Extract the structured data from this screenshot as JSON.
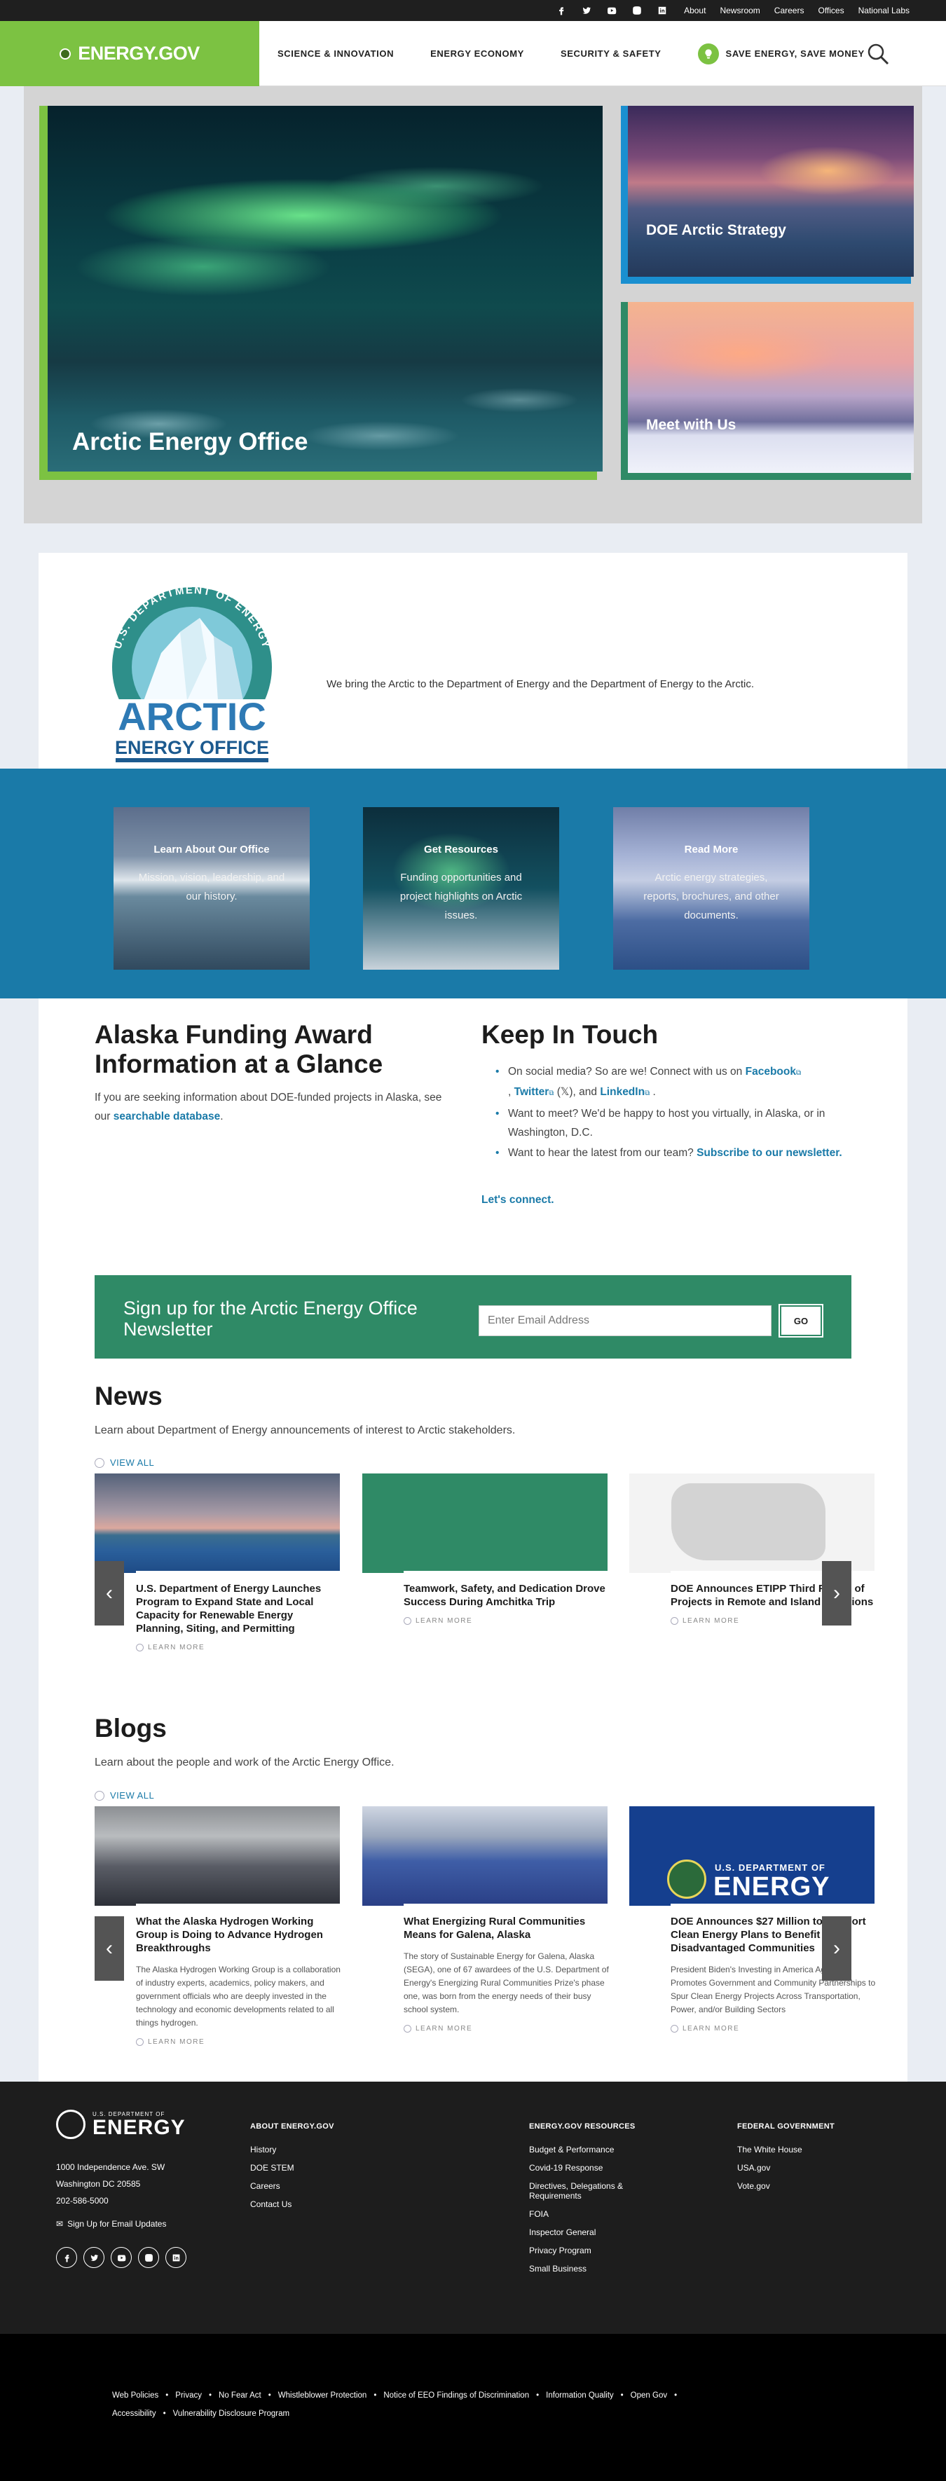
{
  "utility": {
    "icons": [
      "facebook-icon",
      "twitter-icon",
      "youtube-icon",
      "instagram-icon",
      "linkedin-icon"
    ],
    "links": [
      "About",
      "Newsroom",
      "Careers",
      "Offices",
      "National Labs"
    ]
  },
  "header": {
    "logo": "ENERGY.GOV",
    "nav": [
      "SCIENCE & INNOVATION",
      "ENERGY ECONOMY",
      "SECURITY & SAFETY"
    ],
    "save": "SAVE ENERGY, SAVE MONEY"
  },
  "hero": {
    "main_caption": "Arctic Energy Office",
    "side1_caption": "DOE Arctic Strategy",
    "side2_caption": "Meet with Us"
  },
  "intro": {
    "logo_ring": "U.S. DEPARTMENT OF ENERGY",
    "logo_line1": "ARCTIC",
    "logo_line2": "ENERGY OFFICE",
    "text": "We bring the Arctic to the Department of Energy and the Department of Energy to the Arctic."
  },
  "tiles": [
    {
      "title": "Learn About Our Office",
      "desc": "Mission, vision, leadership, and our history."
    },
    {
      "title": "Get Resources",
      "desc": "Funding opportunities and project highlights on Arctic issues."
    },
    {
      "title": "Read More",
      "desc": "Arctic energy strategies, reports, brochures, and other documents."
    }
  ],
  "funding": {
    "heading": "Alaska Funding Award Information at a Glance",
    "text": "If you are seeking information about DOE-funded projects in Alaska, see our",
    "link": "searchable database",
    "end": "."
  },
  "keep": {
    "heading": "Keep In Touch",
    "b1_pre": "On social media? So are we! Connect with us on",
    "b1_fb": "Facebook",
    "b1_mid": ",",
    "b1_tw": "Twitter",
    "b1_x": " (𝕏), and",
    "b1_li": "LinkedIn",
    "b1_end": ".",
    "b2": "Want to meet? We'd be happy to host you virtually, in Alaska, or in Washington, D.C.",
    "b3_pre": "Want to hear the latest from our team?",
    "b3_link": "Subscribe to our newsletter.",
    "cta": "Let's connect."
  },
  "newsletter": {
    "label": "Sign up for the Arctic Energy Office Newsletter",
    "placeholder": "Enter Email Address",
    "button": "GO"
  },
  "news": {
    "heading": "News",
    "text": "Learn about Department of Energy announcements of interest to Arctic stakeholders.",
    "view_all": "VIEW ALL",
    "more": "LEARN MORE",
    "items": [
      {
        "title": "U.S. Department of Energy Launches Program to Expand State and Local Capacity for Renewable Energy Planning, Siting, and Permitting"
      },
      {
        "title": "Teamwork, Safety, and Dedication Drove Success During Amchitka Trip"
      },
      {
        "title": "DOE Announces ETIPP Third Round of Projects in Remote and Island Locations"
      }
    ]
  },
  "blogs": {
    "heading": "Blogs",
    "text": "Learn about the people and work of the Arctic Energy Office.",
    "view_all": "VIEW ALL",
    "more": "LEARN MORE",
    "items": [
      {
        "title": "What the Alaska Hydrogen Working Group is Doing to Advance Hydrogen Breakthroughs",
        "desc": "The Alaska Hydrogen Working Group is a collaboration of industry experts, academics, policy makers, and government officials who are deeply invested in the technology and economic developments related to all things hydrogen."
      },
      {
        "title": "What Energizing Rural Communities Means for Galena, Alaska",
        "desc": "The story of Sustainable Energy for Galena, Alaska (SEGA), one of 67 awardees of the U.S. Department of Energy's Energizing Rural Communities Prize's phase one, was born from the energy needs of their busy school system."
      },
      {
        "title": "DOE Announces $27 Million to Support Clean Energy Plans to Benefit Disadvantaged Communities",
        "desc": "President Biden's Investing in America Agenda Promotes Government and Community Partnerships to Spur Clean Energy Projects Across Transportation, Power, and/or Building Sectors"
      }
    ],
    "b3_img_label1": "U.S. DEPARTMENT OF",
    "b3_img_label2": "ENERGY"
  },
  "footer": {
    "brand_small": "U.S. DEPARTMENT OF",
    "brand_big": "ENERGY",
    "addr1": "1000 Independence Ave. SW",
    "addr2": "Washington DC 20585",
    "phone": "202-586-5000",
    "signup": "Sign Up for Email Updates",
    "social_icons": [
      "facebook-icon",
      "twitter-icon",
      "youtube-icon",
      "instagram-icon",
      "linkedin-icon"
    ],
    "col1": {
      "heading": "ABOUT ENERGY.GOV",
      "items": [
        "History",
        "DOE STEM",
        "Careers",
        "Contact Us"
      ]
    },
    "col2": {
      "heading": "ENERGY.GOV RESOURCES",
      "items": [
        "Budget & Performance",
        "Covid-19 Response",
        "Directives, Delegations & Requirements",
        "FOIA",
        "Inspector General",
        "Privacy Program",
        "Small Business"
      ]
    },
    "col3": {
      "heading": "FEDERAL GOVERNMENT",
      "items": [
        "The White House",
        "USA.gov",
        "Vote.gov"
      ]
    }
  },
  "legal": {
    "row1": [
      "Web Policies",
      "Privacy",
      "No Fear Act",
      "Whistleblower Protection",
      "Notice of EEO Findings of Discrimination",
      "Information Quality",
      "Open Gov"
    ],
    "row2": [
      "Accessibility",
      "Vulnerability Disclosure Program"
    ]
  }
}
